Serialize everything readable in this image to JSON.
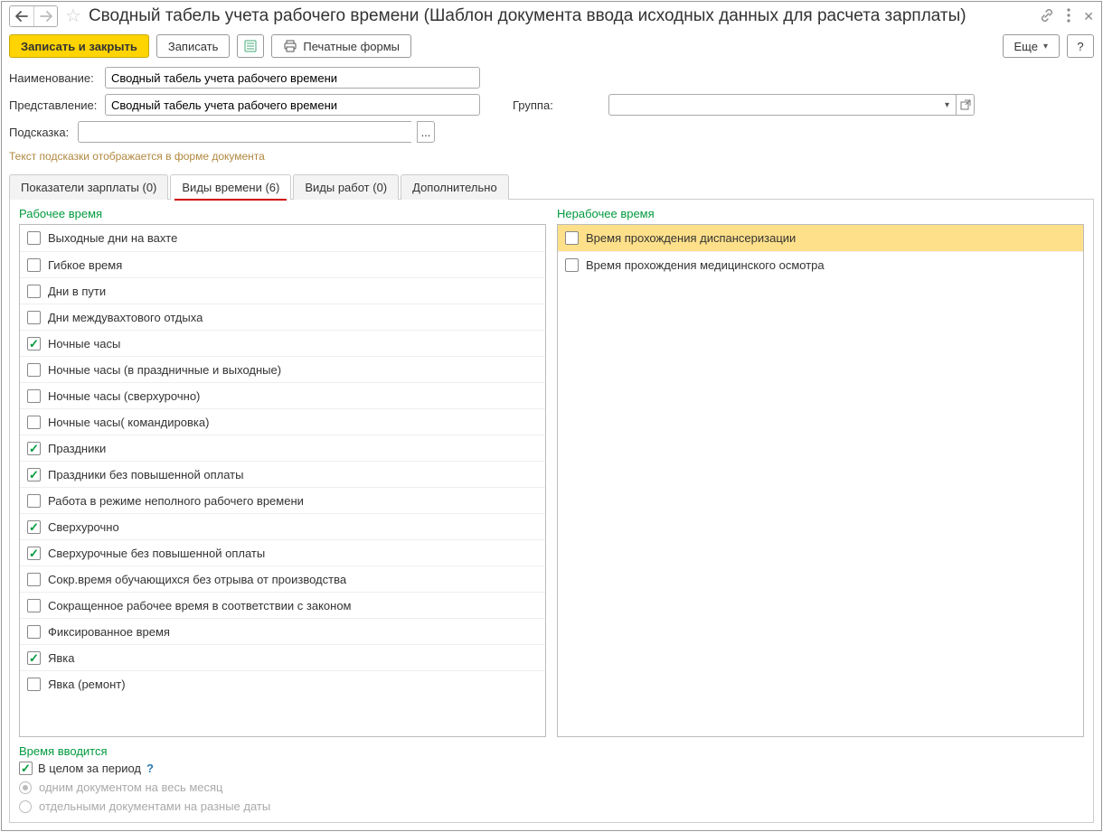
{
  "title": "Сводный табель учета рабочего времени (Шаблон документа ввода исходных данных для расчета зарплаты)",
  "toolbar": {
    "save_close": "Записать и закрыть",
    "save": "Записать",
    "print": "Печатные формы",
    "more": "Еще",
    "help": "?"
  },
  "form": {
    "name_label": "Наименование:",
    "name_value": "Сводный табель учета рабочего времени",
    "repr_label": "Представление:",
    "repr_value": "Сводный табель учета рабочего времени",
    "group_label": "Группа:",
    "group_value": "",
    "hint_label": "Подсказка:",
    "hint_value": "",
    "hint_btn": "...",
    "hint_text": "Текст подсказки отображается в форме документа"
  },
  "tabs": [
    {
      "label": "Показатели зарплаты (0)",
      "active": false
    },
    {
      "label": "Виды времени (6)",
      "active": true
    },
    {
      "label": "Виды работ (0)",
      "active": false
    },
    {
      "label": "Дополнительно",
      "active": false
    }
  ],
  "work_time": {
    "title": "Рабочее время",
    "items": [
      {
        "label": "Выходные дни на вахте",
        "checked": false
      },
      {
        "label": "Гибкое время",
        "checked": false
      },
      {
        "label": "Дни в пути",
        "checked": false
      },
      {
        "label": "Дни междувахтового отдыха",
        "checked": false
      },
      {
        "label": "Ночные часы",
        "checked": true
      },
      {
        "label": "Ночные часы (в праздничные и выходные)",
        "checked": false
      },
      {
        "label": "Ночные часы (сверхурочно)",
        "checked": false
      },
      {
        "label": "Ночные часы( командировка)",
        "checked": false
      },
      {
        "label": "Праздники",
        "checked": true
      },
      {
        "label": "Праздники без повышенной оплаты",
        "checked": true
      },
      {
        "label": "Работа в режиме неполного рабочего времени",
        "checked": false
      },
      {
        "label": "Сверхурочно",
        "checked": true
      },
      {
        "label": "Сверхурочные без повышенной оплаты",
        "checked": true
      },
      {
        "label": "Сокр.время обучающихся без отрыва от производства",
        "checked": false
      },
      {
        "label": "Сокращенное рабочее время в соответствии с законом",
        "checked": false
      },
      {
        "label": "Фиксированное время",
        "checked": false
      },
      {
        "label": "Явка",
        "checked": true
      },
      {
        "label": "Явка (ремонт)",
        "checked": false
      }
    ]
  },
  "nonwork_time": {
    "title": "Нерабочее время",
    "items": [
      {
        "label": "Время прохождения диспансеризации",
        "checked": false,
        "highlight": true
      },
      {
        "label": "Время прохождения медицинского осмотра",
        "checked": false,
        "highlight": false
      }
    ]
  },
  "bottom": {
    "title": "Время вводится",
    "whole_period": "В целом за период",
    "radio1": "одним документом на весь месяц",
    "radio2": "отдельными документами на разные даты"
  }
}
